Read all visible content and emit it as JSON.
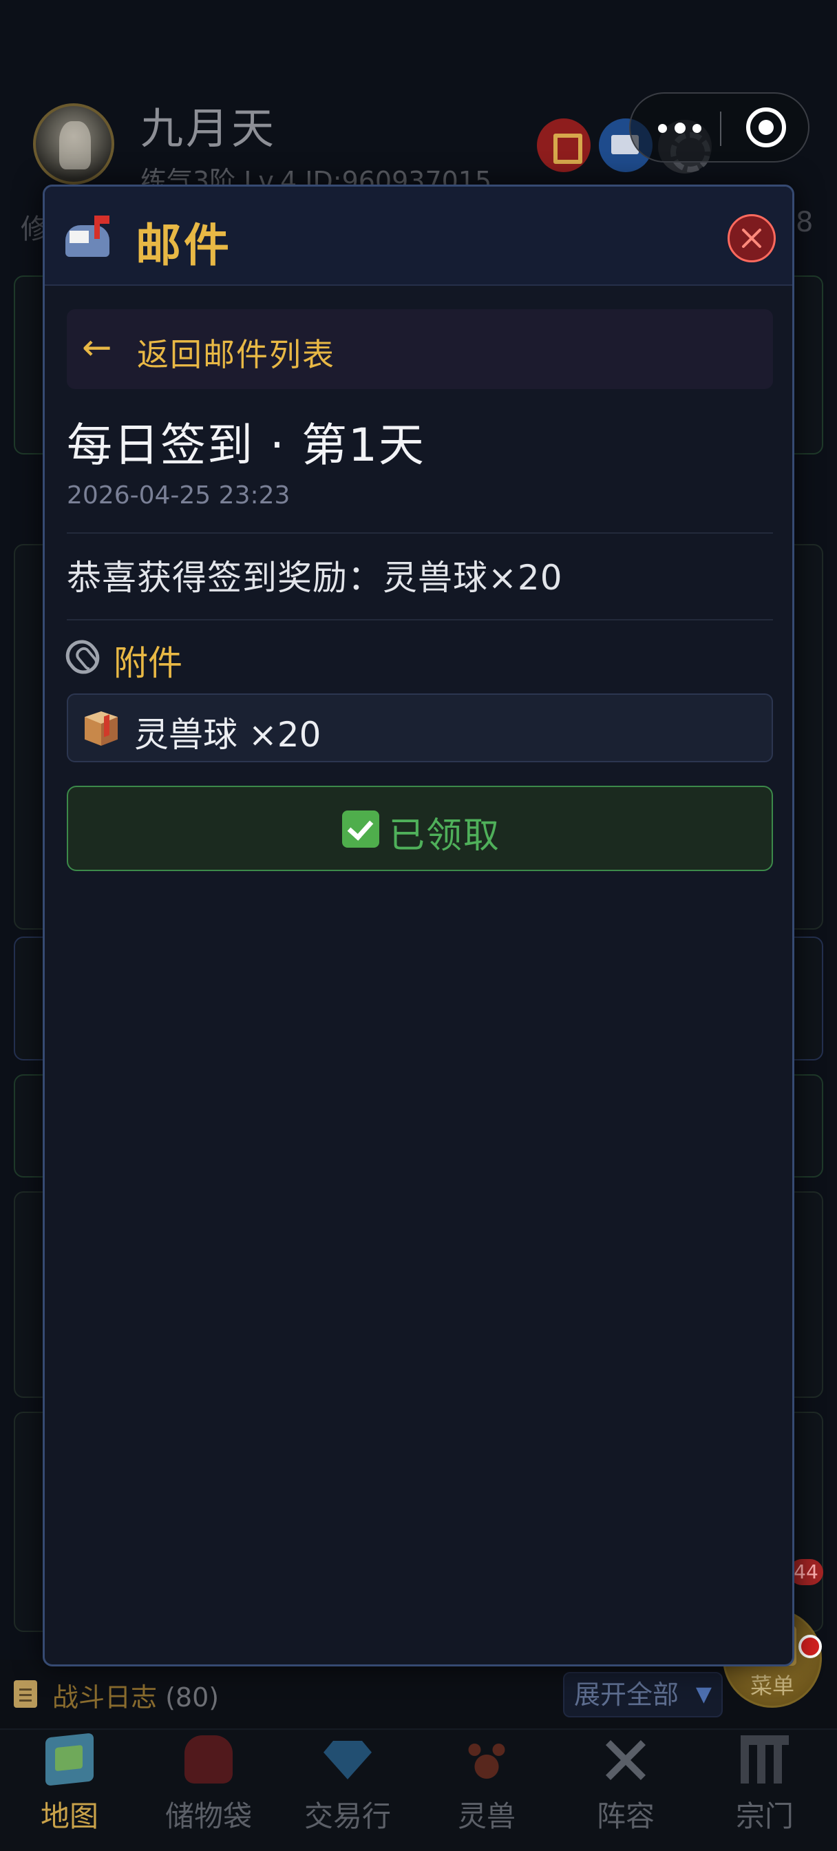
{
  "player": {
    "name": "九月天",
    "level_line": "练气3阶 Lv.4  ID:960937015"
  },
  "background": {
    "side_left": "修",
    "side_right": "8"
  },
  "modal": {
    "title": "邮件",
    "back_label": "返回邮件列表",
    "back_arrow": "←"
  },
  "mail": {
    "title": "每日签到 · 第1天",
    "date": "2026-04-25 23:23",
    "body": "恭喜获得签到奖励：灵兽球×20",
    "attachment_heading": "附件",
    "attachment_item": "灵兽球 ×20",
    "claim_status": "已领取"
  },
  "battle_log": {
    "title": "战斗日志",
    "count": "(80)",
    "expand_label": "展开全部",
    "expand_arrow": "▼"
  },
  "menu": {
    "label": "菜单",
    "badge": "44"
  },
  "tabbar": {
    "tabs": [
      {
        "label": "地图",
        "icon": "map-icon"
      },
      {
        "label": "储物袋",
        "icon": "bag-icon"
      },
      {
        "label": "交易行",
        "icon": "gem-icon"
      },
      {
        "label": "灵兽",
        "icon": "paw-icon"
      },
      {
        "label": "阵容",
        "icon": "swords-icon"
      },
      {
        "label": "宗门",
        "icon": "temple-icon"
      }
    ],
    "active_index": 0
  },
  "colors": {
    "accent_gold": "#e8b845",
    "claimed_green": "#4fb05a",
    "close_red": "#7e1b1f",
    "modal_border": "#364a72"
  }
}
